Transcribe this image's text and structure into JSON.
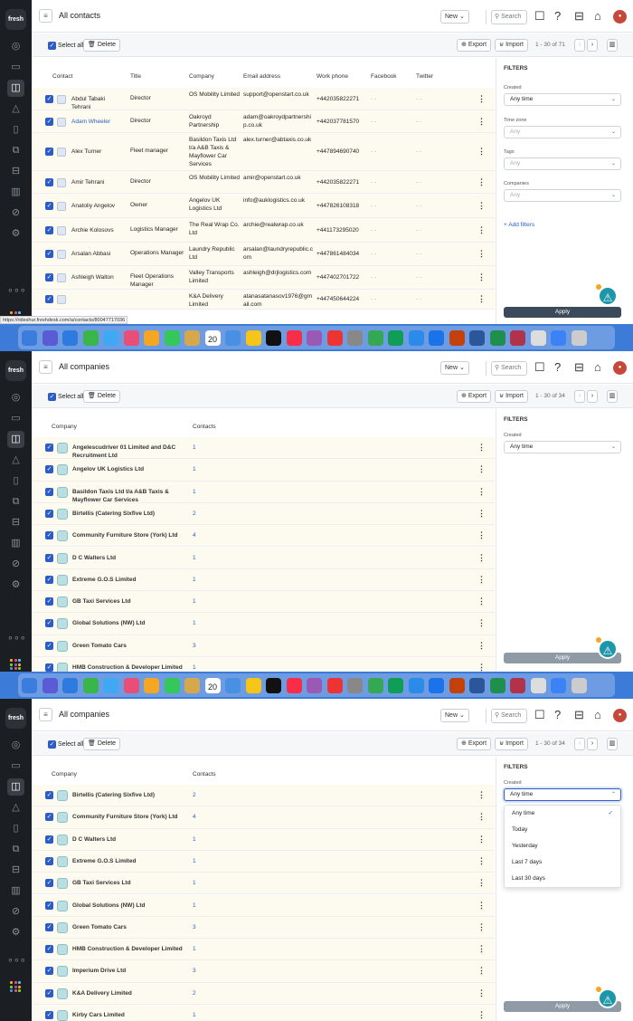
{
  "colors": {
    "accent": "#2c5cc5",
    "nav_bg": "#1b1e22",
    "row_bg": "#fdfbf0",
    "fab": "#1c96a8"
  },
  "header_icons": [
    "notification-icon",
    "help-icon",
    "calendar-icon",
    "marketplace-icon"
  ],
  "s1": {
    "title": "All contacts",
    "new_label": "New",
    "search_placeholder": "Search",
    "select_all": "Select all",
    "delete_label": "Delete",
    "export_label": "Export",
    "import_label": "Import",
    "pagination": "1 - 30 of 71",
    "columns": {
      "contact": "Contact",
      "title": "Title",
      "company": "Company",
      "email": "Email address",
      "phone": "Work phone",
      "facebook": "Facebook",
      "twitter": "Twitter"
    },
    "rows": [
      {
        "name": "Abdul Tabaki Tehrani",
        "title": "Director",
        "company": "OS Mobility Limited",
        "email": "support@openstart.co.uk",
        "phone": "+442035822271",
        "fb": "- -",
        "tw": "- -"
      },
      {
        "name": "Adam Wheeler",
        "title": "Director",
        "company": "Oakroyd Partnership",
        "email": "adam@oakroydpartnership.co.uk",
        "phone": "+442037781570",
        "fb": "- -",
        "tw": "- -"
      },
      {
        "name": "Alex Turner",
        "title": "Fleet manager",
        "company": "Basildon Taxis Ltd t/a A&B Taxis & Mayflower Car Services",
        "email": "alex.turner@abtaxis.co.uk",
        "phone": "+447894690740",
        "fb": "- -",
        "tw": "- -"
      },
      {
        "name": "Amir Tehrani",
        "title": "Director",
        "company": "OS Mobility Limited",
        "email": "amir@openstart.co.uk",
        "phone": "+442035822271",
        "fb": "- -",
        "tw": "- -"
      },
      {
        "name": "Anatoliy Angelov",
        "title": "Owner",
        "company": "Angelov UK Logistics Ltd",
        "email": "info@auklogistics.co.uk",
        "phone": "+447826108318",
        "fb": "- -",
        "tw": "- -"
      },
      {
        "name": "Archie Kolosovs",
        "title": "Logistics Manager",
        "company": "The Real Wrap Co. Ltd",
        "email": "archie@realwrap.co.uk",
        "phone": "+441173295020",
        "fb": "- -",
        "tw": "- -"
      },
      {
        "name": "Arsalan Abbasi",
        "title": "Operations Manager",
        "company": "Laundry Republic Ltd",
        "email": "arsalan@laundryrepublic.com",
        "phone": "+447861484034",
        "fb": "- -",
        "tw": "- -"
      },
      {
        "name": "Ashleigh Walton",
        "title": "Fleet Operations Manager",
        "company": "Valley Transports Limited",
        "email": "ashleigh@drjlogistics.com",
        "phone": "+447402701722",
        "fb": "- -",
        "tw": "- -"
      },
      {
        "name": "",
        "title": "",
        "company": "K&A Delivery Limited",
        "email": "atanasatanasov1976@gmail.com",
        "phone": "+447450644224",
        "fb": "- -",
        "tw": "- -"
      }
    ],
    "filters": {
      "heading": "FILTERS",
      "created_label": "Created",
      "created_value": "Any time",
      "timezone_label": "Time zone",
      "timezone_value": "Any",
      "tags_label": "Tags",
      "tags_value": "Any",
      "companies_label": "Companies",
      "companies_value": "Any",
      "add_filters": "+ Add filters",
      "apply": "Apply"
    },
    "status_url": "https://rideshur.freshdesk.com/a/contacts/80047717036"
  },
  "s2": {
    "title": "All companies",
    "new_label": "New",
    "search_placeholder": "Search",
    "select_all": "Select all",
    "delete_label": "Delete",
    "export_label": "Export",
    "import_label": "Import",
    "pagination": "1 - 30 of 34",
    "columns": {
      "company": "Company",
      "contacts": "Contacts"
    },
    "rows": [
      {
        "name": "Angelescudriver 01 Limited and D&C Recruitment Ltd",
        "contacts": "1"
      },
      {
        "name": "Angelov UK Logistics Ltd",
        "contacts": "1"
      },
      {
        "name": "Basildon Taxis Ltd t/a A&B Taxis & Mayflower Car Services",
        "contacts": "1"
      },
      {
        "name": "Birtellis (Catering Sixfive Ltd)",
        "contacts": "2"
      },
      {
        "name": "Community Furniture Store (York) Ltd",
        "contacts": "4"
      },
      {
        "name": "D C Walters Ltd",
        "contacts": "1"
      },
      {
        "name": "Extreme G.O.S Limited",
        "contacts": "1"
      },
      {
        "name": "GB Taxi Services Ltd",
        "contacts": "1"
      },
      {
        "name": "Global Solutions (NW) Ltd",
        "contacts": "1"
      },
      {
        "name": "Green Tomato Cars",
        "contacts": "3"
      },
      {
        "name": "HMB Construction & Developer Limited",
        "contacts": "1"
      }
    ],
    "filters": {
      "heading": "FILTERS",
      "created_label": "Created",
      "created_value": "Any time",
      "apply": "Apply"
    }
  },
  "s3": {
    "title": "All companies",
    "new_label": "New",
    "search_placeholder": "Search",
    "select_all": "Select all",
    "delete_label": "Delete",
    "export_label": "Export",
    "import_label": "Import",
    "pagination": "1 - 30 of 34",
    "columns": {
      "company": "Company",
      "contacts": "Contacts"
    },
    "rows": [
      {
        "name": "Birtellis (Catering Sixfive Ltd)",
        "contacts": "2"
      },
      {
        "name": "Community Furniture Store (York) Ltd",
        "contacts": "4"
      },
      {
        "name": "D C Walters Ltd",
        "contacts": "1"
      },
      {
        "name": "Extreme G.O.S Limited",
        "contacts": "1"
      },
      {
        "name": "GB Taxi Services Ltd",
        "contacts": "1"
      },
      {
        "name": "Global Solutions (NW) Ltd",
        "contacts": "1"
      },
      {
        "name": "Green Tomato Cars",
        "contacts": "3"
      },
      {
        "name": "HMB Construction & Developer Limited",
        "contacts": "1"
      },
      {
        "name": "Imperium Drive Ltd",
        "contacts": "3"
      },
      {
        "name": "K&A Delivery Limited",
        "contacts": "2"
      },
      {
        "name": "Kirby Cars Limited",
        "contacts": "1"
      }
    ],
    "filters": {
      "heading": "FILTERS",
      "created_label": "Created",
      "created_value": "Any time",
      "apply": "Apply"
    },
    "dropdown": {
      "options": [
        "Any time",
        "Today",
        "Yesterday",
        "Last 7 days",
        "Last 30 days"
      ],
      "selected": "Any time"
    }
  },
  "dock_calendar_day": "20"
}
